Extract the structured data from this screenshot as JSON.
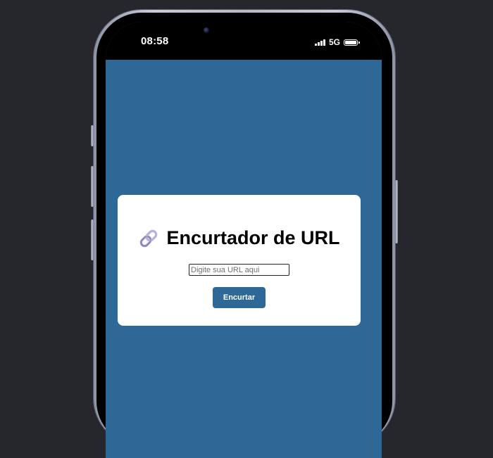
{
  "status_bar": {
    "time": "08:58",
    "network": "5G",
    "signal_icon": "signal-bars-icon",
    "battery_icon": "battery-icon"
  },
  "card": {
    "title_icon": "link-icon",
    "title": "Encurtador de URL",
    "input": {
      "value": "",
      "placeholder": "Digite sua URL aqui"
    },
    "button_label": "Encurtar"
  },
  "colors": {
    "page_background": "#25272c",
    "screen_background": "#2d6896",
    "card_background": "#ffffff",
    "button_background": "#2d6896",
    "button_text": "#ffffff"
  }
}
